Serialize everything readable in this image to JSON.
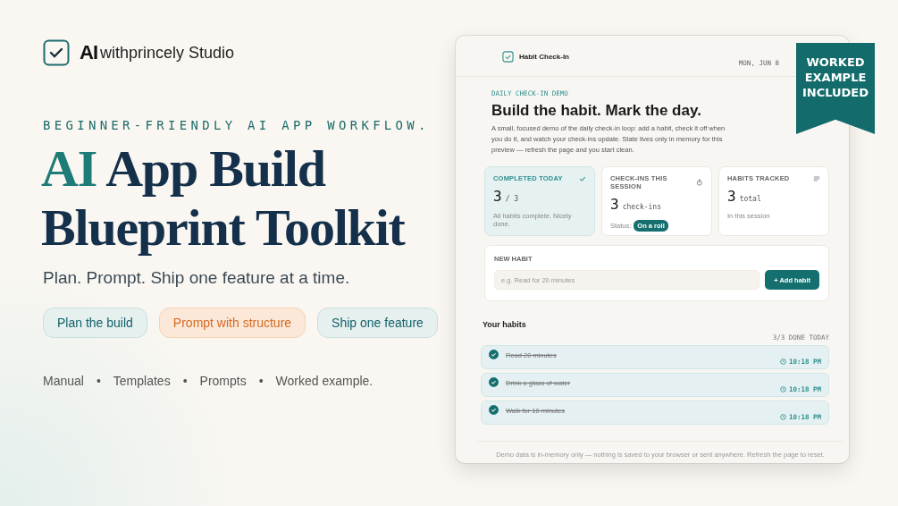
{
  "brand": {
    "mark": "AI",
    "name": "withprincely Studio"
  },
  "eyebrow": "BEGINNER-FRIENDLY AI APP WORKFLOW.",
  "headline": [
    [
      {
        "text": "AI",
        "accent": true
      },
      {
        "text": " App Build",
        "accent": false
      }
    ],
    [
      {
        "text": "Blueprint Toolkit",
        "accent": false
      }
    ]
  ],
  "tagline": "Plan. Prompt. Ship one feature at a time.",
  "pills": [
    {
      "label": "Plan the build",
      "kind": "teal"
    },
    {
      "label": "Prompt with structure",
      "kind": "orange"
    },
    {
      "label": "Ship one feature",
      "kind": "teal"
    }
  ],
  "includes": [
    "Manual",
    "•",
    "Templates",
    "•",
    "Prompts",
    "•",
    "Worked example."
  ],
  "ribbon": [
    "WORKED",
    "EXAMPLE",
    "INCLUDED"
  ],
  "app": {
    "title": "Habit Check-In",
    "date": "MON, JUN 8",
    "eyebrow": "DAILY CHECK-IN DEMO",
    "heading": "Build the habit. Mark the day.",
    "intro": "A small, focused demo of the daily check-in loop: add a habit, check it off when you do it, and watch your check-ins update. State lives only in memory for this preview — refresh the page and you start clean.",
    "stats": [
      {
        "kind": "check",
        "label": "COMPLETED TODAY",
        "value": "3",
        "unit": "/ 3",
        "note": "All habits complete. Nicely done.",
        "highlighted": true
      },
      {
        "kind": "timer",
        "label": "CHECK-INS THIS SESSION",
        "value": "3",
        "unit": "check-ins",
        "note": "Status:",
        "chip": "On a roll",
        "highlighted": false
      },
      {
        "kind": "lines",
        "label": "HABITS TRACKED",
        "value": "3",
        "unit": "total",
        "note": "In this session",
        "highlighted": false
      }
    ],
    "new_habit": {
      "label": "NEW HABIT",
      "placeholder": "e.g. Read for 20 minutes",
      "button": "+ Add habit"
    },
    "list_title": "Your habits",
    "list_count": "3/3 DONE TODAY",
    "habits": [
      {
        "name": "Read 20 minutes",
        "time": "10:18 PM",
        "checked": true
      },
      {
        "name": "Drink a glass of water",
        "time": "10:18 PM",
        "checked": true
      },
      {
        "name": "Walk for 10 minutes",
        "time": "10:18 PM",
        "checked": true
      }
    ],
    "footer": "Demo data is in-memory only — nothing is saved to your browser or sent anywhere. Refresh the page to reset."
  }
}
